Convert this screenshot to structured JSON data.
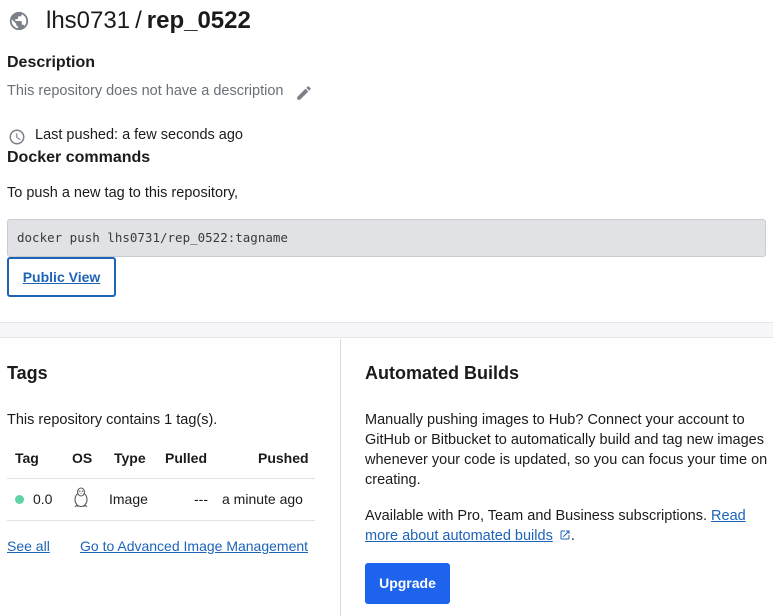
{
  "repo": {
    "owner": "lhs0731",
    "separator": "/",
    "name": "rep_0522"
  },
  "description": {
    "heading": "Description",
    "text": "This repository does not have a description"
  },
  "last_pushed": "Last pushed: a few seconds ago",
  "docker_commands": {
    "heading": "Docker commands",
    "intro": "To push a new tag to this repository,",
    "command": "docker push lhs0731/rep_0522:tagname",
    "public_view_label": "Public View"
  },
  "tags": {
    "heading": "Tags",
    "count_text": "This repository contains 1 tag(s).",
    "columns": [
      "Tag",
      "OS",
      "Type",
      "Pulled",
      "Pushed"
    ],
    "rows": [
      {
        "tag": "0.0",
        "os": "linux-icon",
        "type": "Image",
        "pulled": "---",
        "pushed": "a minute ago"
      }
    ],
    "see_all": "See all",
    "advanced_link": "Go to Advanced Image Management"
  },
  "automated_builds": {
    "heading": "Automated Builds",
    "paragraph": "Manually pushing images to Hub? Connect your account to GitHub or Bitbucket to automatically build and tag new images whenever your code is updated, so you can focus your time on creating.",
    "availability": "Available with Pro, Team and Business subscriptions.",
    "read_more_link": "Read more about automated builds",
    "period": ".",
    "upgrade_label": "Upgrade"
  },
  "colors": {
    "link_blue": "#1d63b8",
    "button_blue": "#1d63ed",
    "tag_status_green": "#5fd3a4"
  }
}
